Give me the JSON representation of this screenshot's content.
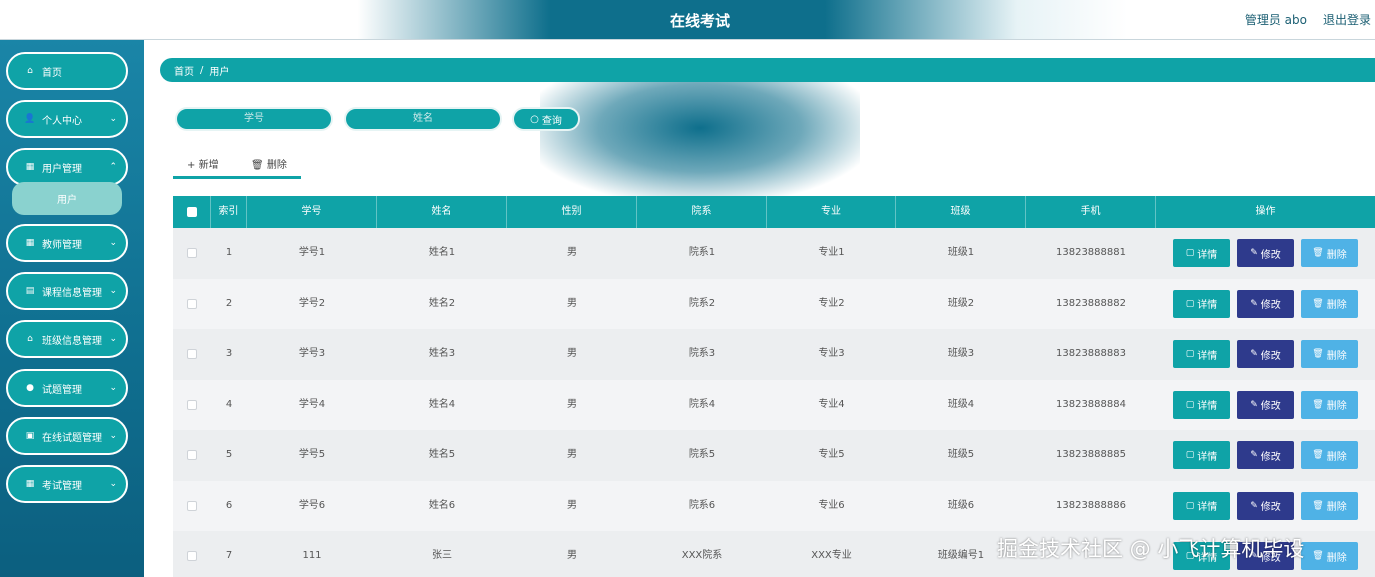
{
  "header": {
    "title": "在线考试",
    "user": "管理员 abo",
    "logout": "退出登录"
  },
  "sidebar": {
    "items": [
      {
        "label": "首页",
        "icon": "home-icon",
        "has_chevron": false
      },
      {
        "label": "个人中心",
        "icon": "user-icon",
        "has_chevron": true
      },
      {
        "label": "用户管理",
        "icon": "grid-icon",
        "has_chevron": true
      },
      {
        "label": "教师管理",
        "icon": "grid-icon",
        "has_chevron": true
      },
      {
        "label": "课程信息管理",
        "icon": "clipboard-icon",
        "has_chevron": true
      },
      {
        "label": "班级信息管理",
        "icon": "home-icon",
        "has_chevron": true
      },
      {
        "label": "试题管理",
        "icon": "bulb-icon",
        "has_chevron": true
      },
      {
        "label": "在线试题管理",
        "icon": "grid-icon",
        "has_chevron": true
      },
      {
        "label": "考试管理",
        "icon": "grid-icon",
        "has_chevron": true
      }
    ],
    "sub_item": "用户"
  },
  "breadcrumb": {
    "home": "首页",
    "sep": "/",
    "current": "用户"
  },
  "search": {
    "student_id_placeholder": "学号",
    "name_placeholder": "姓名",
    "query_label": "查询"
  },
  "toolbar": {
    "add_label": "新增",
    "delete_label": "删除"
  },
  "table": {
    "columns": [
      "索引",
      "学号",
      "姓名",
      "性别",
      "院系",
      "专业",
      "班级",
      "手机",
      "操作"
    ],
    "rows": [
      {
        "index": "1",
        "student_id": "学号1",
        "name": "姓名1",
        "gender": "男",
        "dept": "院系1",
        "major": "专业1",
        "class": "班级1",
        "phone": "13823888881"
      },
      {
        "index": "2",
        "student_id": "学号2",
        "name": "姓名2",
        "gender": "男",
        "dept": "院系2",
        "major": "专业2",
        "class": "班级2",
        "phone": "13823888882"
      },
      {
        "index": "3",
        "student_id": "学号3",
        "name": "姓名3",
        "gender": "男",
        "dept": "院系3",
        "major": "专业3",
        "class": "班级3",
        "phone": "13823888883"
      },
      {
        "index": "4",
        "student_id": "学号4",
        "name": "姓名4",
        "gender": "男",
        "dept": "院系4",
        "major": "专业4",
        "class": "班级4",
        "phone": "13823888884"
      },
      {
        "index": "5",
        "student_id": "学号5",
        "name": "姓名5",
        "gender": "男",
        "dept": "院系5",
        "major": "专业5",
        "class": "班级5",
        "phone": "13823888885"
      },
      {
        "index": "6",
        "student_id": "学号6",
        "name": "姓名6",
        "gender": "男",
        "dept": "院系6",
        "major": "专业6",
        "class": "班级6",
        "phone": "13823888886"
      },
      {
        "index": "7",
        "student_id": "111",
        "name": "张三",
        "gender": "男",
        "dept": "XXX院系",
        "major": "XXX专业",
        "class": "班级编号1",
        "phone": ""
      }
    ],
    "actions": {
      "detail": "详情",
      "edit": "修改",
      "delete": "删除"
    }
  },
  "watermark": "掘金技术社区 @ 小飞计算机毕设",
  "colors": {
    "primary": "#0fa3a7",
    "header_dark": "#0e6f8c",
    "edit": "#2e3a8c",
    "delete": "#4fb2e6"
  }
}
